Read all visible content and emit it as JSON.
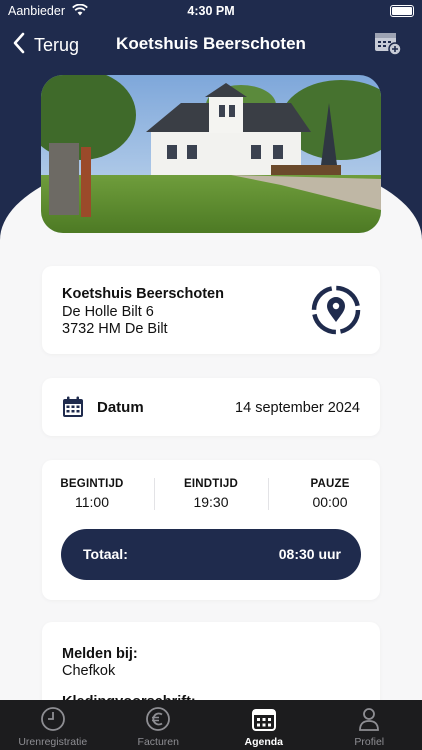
{
  "status": {
    "carrier": "Aanbieder",
    "time": "4:30 PM"
  },
  "nav": {
    "back_label": "Terug",
    "title": "Koetshuis Beerschoten"
  },
  "location": {
    "name": "Koetshuis Beerschoten",
    "address_line1": "De Holle Bilt 6",
    "address_line2": "3732 HM De Bilt"
  },
  "date": {
    "label": "Datum",
    "value": "14 september 2024"
  },
  "times": {
    "start_label": "BEGINTIJD",
    "start_value": "11:00",
    "end_label": "EINDTIJD",
    "end_value": "19:30",
    "pause_label": "PAUZE",
    "pause_value": "00:00",
    "total_label": "Totaal:",
    "total_value": "08:30 uur"
  },
  "report": {
    "label": "Melden bij:",
    "value": "Chefkok",
    "next_label": "Kledingvoorschrift:"
  },
  "tabs": [
    {
      "label": "Urenregistratie",
      "icon": "clock-icon"
    },
    {
      "label": "Facturen",
      "icon": "euro-icon"
    },
    {
      "label": "Agenda",
      "icon": "calendar-icon"
    },
    {
      "label": "Profiel",
      "icon": "person-icon"
    }
  ],
  "colors": {
    "navy": "#1f2b4d",
    "tabbar": "#1c1c1e",
    "background": "#f7f7f8"
  }
}
